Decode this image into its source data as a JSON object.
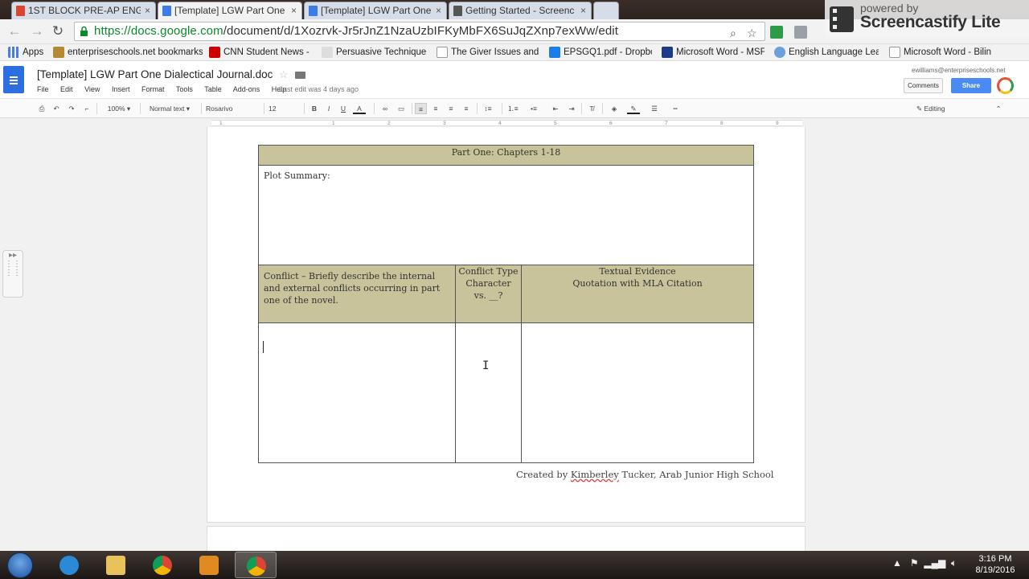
{
  "browser": {
    "tabs": [
      {
        "label": "1ST BLOCK PRE-AP ENGLI",
        "active": false,
        "icon": "slides-icon"
      },
      {
        "label": "[Template] LGW Part One",
        "active": true,
        "icon": "docs-icon"
      },
      {
        "label": "[Template] LGW Part One",
        "active": false,
        "icon": "docs-icon"
      },
      {
        "label": "Getting Started - Screenc",
        "active": false,
        "icon": "screencastify-icon"
      }
    ],
    "url_host": "https://docs.google.com",
    "url_path": "/document/d/1Xozrvk-Jr5rJnZ1NzaUzbIFKyMbFX6SuJqZXnp7exWw/edit",
    "bookmarks": [
      "Apps",
      "enterpriseschools.net bookmarks",
      "CNN Student News -",
      "Persuasive Technique",
      "The Giver Issues and T",
      "EPSGQ1.pdf - Dropbo",
      "Microsoft Word - MSF",
      "English Language Lea",
      "Microsoft Word - Bilin"
    ]
  },
  "docs": {
    "title": "[Template] LGW Part One Dialectical Journal.doc",
    "menus": [
      "File",
      "Edit",
      "View",
      "Insert",
      "Format",
      "Tools",
      "Table",
      "Add-ons",
      "Help"
    ],
    "last_edit": "Last edit was 4 days ago",
    "account_email": "ewilliams@enterpriseschools.net",
    "comments_label": "Comments",
    "share_label": "Share",
    "notification_count": "24"
  },
  "format_toolbar": {
    "zoom": "100%",
    "style": "Normal text",
    "font": "Rosarivo",
    "size": "12",
    "mode": "Editing"
  },
  "ruler_numbers": [
    "1",
    "1",
    "2",
    "3",
    "4",
    "5",
    "6",
    "7",
    "8",
    "9"
  ],
  "document": {
    "table_title": "Part One: Chapters 1-18",
    "plot_summary_label": "Plot Summary:",
    "conflict_header": "Conflict – Briefly describe the internal and external conflicts occurring in part one of the novel.",
    "conflict_type_header": "Conflict Type Character vs. __?",
    "evidence_header_line1": "Textual Evidence",
    "evidence_header_line2": "Quotation with MLA Citation",
    "credit_prefix": "Created by ",
    "credit_name": "Kimberley",
    "credit_suffix": " Tucker, Arab Junior High School"
  },
  "watermark": {
    "line1": "powered by",
    "line2": "Screencastify Lite"
  },
  "taskbar": {
    "time": "3:16 PM",
    "date": "8/19/2016"
  },
  "colors": {
    "table_header_tan": "#c8c39a",
    "docs_blue": "#2d6ee0",
    "share_blue": "#4a8af4"
  }
}
